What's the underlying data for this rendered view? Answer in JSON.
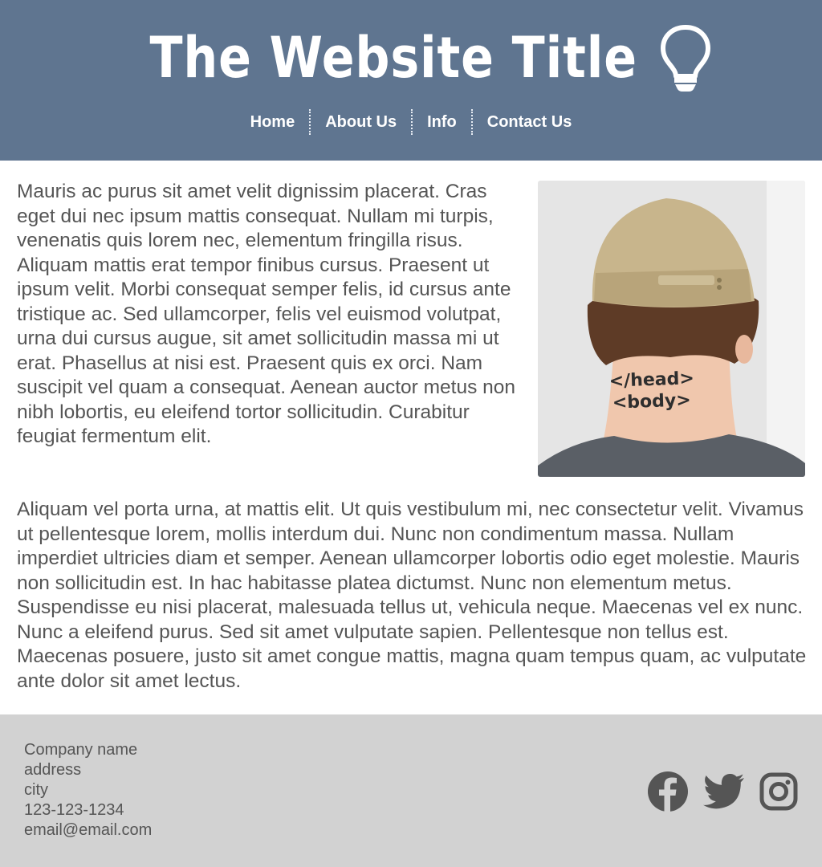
{
  "header": {
    "title": "The Website Title",
    "logo_icon": "lightbulb-icon",
    "background_color": "#5f7590"
  },
  "nav": {
    "items": [
      {
        "label": "Home"
      },
      {
        "label": "About Us"
      },
      {
        "label": "Info"
      },
      {
        "label": "Contact Us"
      }
    ]
  },
  "main": {
    "paragraph_1": "Mauris ac purus sit amet velit dignissim placerat. Cras eget dui nec ipsum mattis consequat. Nullam mi turpis, venenatis quis lorem nec, elementum fringilla risus. Aliquam mattis erat tempor finibus cursus. Praesent ut ipsum velit. Morbi consequat semper felis, id cursus ante tristique ac. Sed ullamcorper, felis vel euismod volutpat, urna dui cursus augue, sit amet sollicitudin massa mi ut erat. Phasellus at nisi est. Praesent quis ex orci. Nam suscipit vel quam a consequat. Aenean auctor metus non nibh lobortis, eu eleifend tortor sollicitudin. Curabitur feugiat fermentum elit.",
    "paragraph_2": "Aliquam vel porta urna, at mattis elit. Ut quis vestibulum mi, nec consectetur velit. Vivamus ut pellentesque lorem, mollis interdum dui. Nunc non condimentum massa. Nullam imperdiet ultricies diam et semper. Aenean ullamcorper lobortis odio eget molestie. Mauris non sollicitudin est. In hac habitasse platea dictumst. Nunc non elementum metus. Suspendisse eu nisi placerat, malesuada tellus ut, vehicula neque. Maecenas vel ex nunc. Nunc a eleifend purus. Sed sit amet vulputate sapien. Pellentesque non tellus est. Maecenas posuere, justo sit amet congue mattis, magna quam tempus quam, ac vulputate ante dolor sit amet lectus.",
    "photo": {
      "tattoo_line_1": "</head>",
      "tattoo_line_2": "<body>"
    }
  },
  "footer": {
    "company": "Company name",
    "address": "address",
    "city": "city",
    "phone": "123-123-1234",
    "email": "email@email.com",
    "social_icons": [
      "facebook-icon",
      "twitter-icon",
      "instagram-icon"
    ],
    "background_color": "#d2d2d2",
    "icon_color": "#555555"
  }
}
